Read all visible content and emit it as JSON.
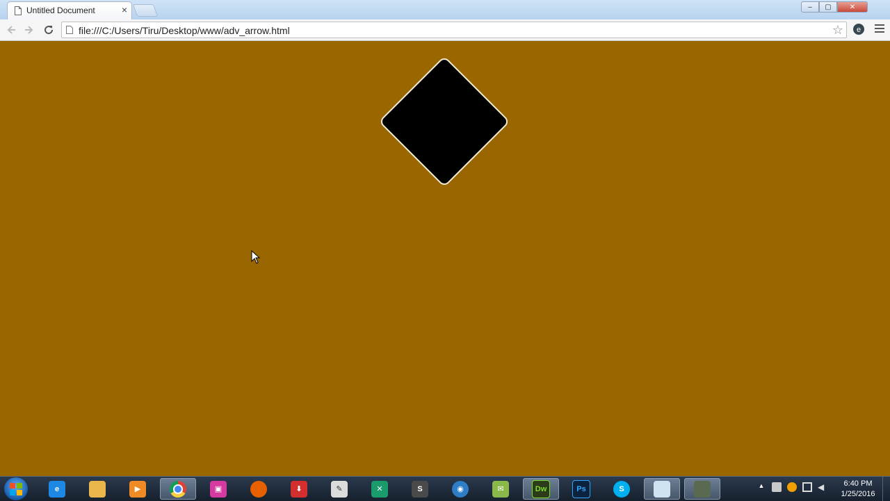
{
  "browser": {
    "tab": {
      "title": "Untitled Document",
      "close_glyph": "×"
    },
    "nav": {
      "back_icon": "back-arrow-icon",
      "forward_icon": "forward-arrow-icon",
      "reload_icon": "reload-icon"
    },
    "address_bar": {
      "url": "file:///C:/Users/Tiru/Desktop/www/adv_arrow.html"
    },
    "window_controls": {
      "minimize": "‒",
      "maximize": "▢",
      "close": "✕"
    }
  },
  "page": {
    "background_color": "#9a6600",
    "shape": {
      "fill": "#000000",
      "border": "#f2ecd9"
    }
  },
  "taskbar": {
    "apps": [
      {
        "name": "internet-explorer",
        "label": "e",
        "color": "#1e88e5"
      },
      {
        "name": "file-explorer",
        "label": "",
        "color": "#e8b64a"
      },
      {
        "name": "media-player",
        "label": "▶",
        "color": "#f08a24"
      },
      {
        "name": "chrome",
        "label": "",
        "color": "#ffffff",
        "active": true
      },
      {
        "name": "app-pink",
        "label": "▣",
        "color": "#d43aa0"
      },
      {
        "name": "firefox",
        "label": "",
        "color": "#e66000"
      },
      {
        "name": "app-red",
        "label": "⬇",
        "color": "#d32f2f"
      },
      {
        "name": "notepad",
        "label": "✎",
        "color": "#dcdcdc"
      },
      {
        "name": "app-green-x",
        "label": "✕",
        "color": "#1a9b6b"
      },
      {
        "name": "sublime-text",
        "label": "S",
        "color": "#4a4a4a"
      },
      {
        "name": "globe-app",
        "label": "◉",
        "color": "#2e7dc7"
      },
      {
        "name": "app-mail",
        "label": "✉",
        "color": "#8ab84a"
      },
      {
        "name": "dreamweaver",
        "label": "Dw",
        "color": "#2c3b1a",
        "active": true
      },
      {
        "name": "photoshop",
        "label": "Ps",
        "color": "#0c2340"
      },
      {
        "name": "skype",
        "label": "S",
        "color": "#00aff0"
      },
      {
        "name": "app-note",
        "label": "",
        "color": "#cfe3f1",
        "active": true
      },
      {
        "name": "app-pen",
        "label": "",
        "color": "#5a6a50",
        "active": true
      }
    ],
    "clock": {
      "time": "6:40 PM",
      "date": "1/25/2016"
    }
  }
}
